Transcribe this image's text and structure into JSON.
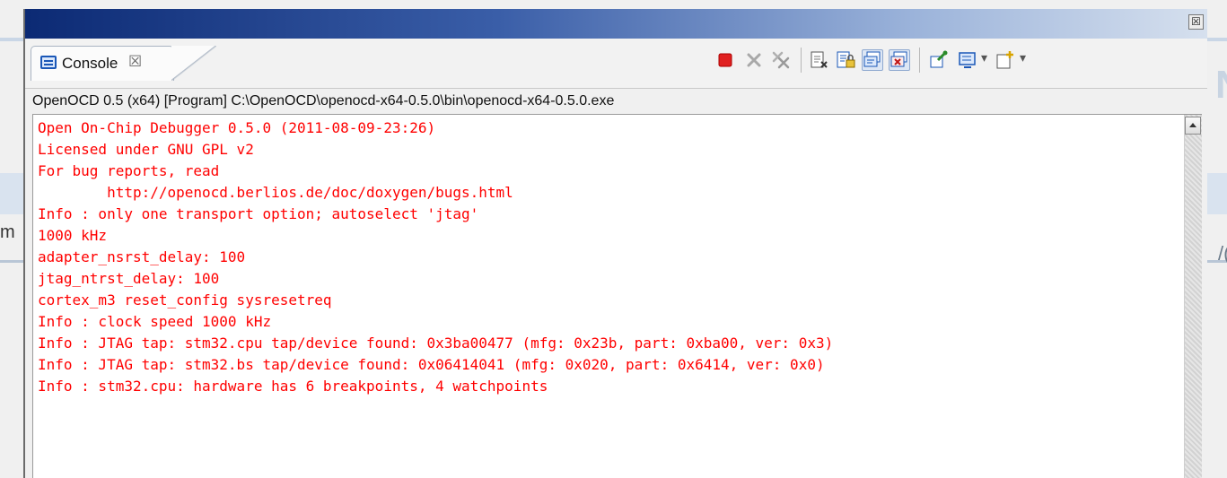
{
  "background": {
    "left_char": "m",
    "right_char": "/(",
    "right_big_char": "N"
  },
  "window": {
    "close_glyph": "☒"
  },
  "tab": {
    "label": "Console",
    "close_glyph": "☒",
    "icon": "console-icon"
  },
  "toolbar": {
    "buttons": [
      {
        "name": "terminate-icon",
        "color": "#e02020"
      },
      {
        "name": "remove-launch-icon",
        "color": "#9a9a9a"
      },
      {
        "name": "remove-all-terminated-icon",
        "color": "#9a9a9a"
      },
      {
        "name": "clear-console-icon",
        "color": "#1a57b7"
      },
      {
        "name": "scroll-lock-icon",
        "color": "#1a57b7"
      },
      {
        "name": "show-console-on-stdout-icon",
        "color": "#1a57b7"
      },
      {
        "name": "show-console-on-stderr-icon",
        "color": "#c01515"
      },
      {
        "name": "pin-console-icon",
        "color": "#2a8a2a"
      },
      {
        "name": "display-selected-console-icon",
        "color": "#1a57b7"
      },
      {
        "name": "open-console-icon",
        "color": "#d8a400"
      }
    ],
    "dropdown_glyph": "▾"
  },
  "path": "OpenOCD 0.5 (x64) [Program] C:\\OpenOCD\\openocd-x64-0.5.0\\bin\\openocd-x64-0.5.0.exe",
  "console": {
    "text_color": "#ff0000",
    "lines": [
      "Open On-Chip Debugger 0.5.0 (2011-08-09-23:26)",
      "Licensed under GNU GPL v2",
      "For bug reports, read",
      "        http://openocd.berlios.de/doc/doxygen/bugs.html",
      "Info : only one transport option; autoselect 'jtag'",
      "1000 kHz",
      "adapter_nsrst_delay: 100",
      "jtag_ntrst_delay: 100",
      "cortex_m3 reset_config sysresetreq",
      "Info : clock speed 1000 kHz",
      "Info : JTAG tap: stm32.cpu tap/device found: 0x3ba00477 (mfg: 0x23b, part: 0xba00, ver: 0x3)",
      "Info : JTAG tap: stm32.bs tap/device found: 0x06414041 (mfg: 0x020, part: 0x6414, ver: 0x0)",
      "Info : stm32.cpu: hardware has 6 breakpoints, 4 watchpoints"
    ]
  }
}
